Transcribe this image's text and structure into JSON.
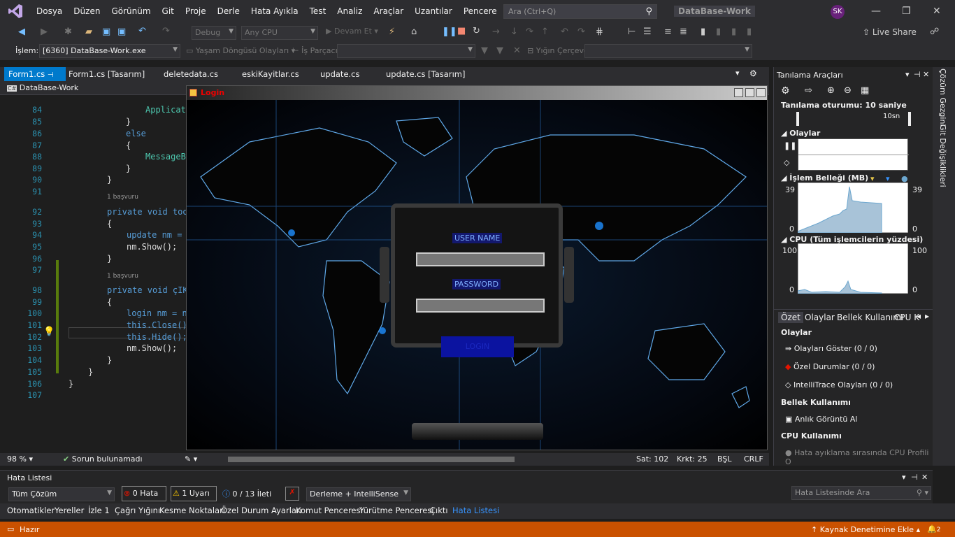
{
  "menu": {
    "items": [
      "Dosya",
      "Düzen",
      "Görünüm",
      "Git",
      "Proje",
      "Derle",
      "Hata Ayıkla",
      "Test",
      "Analiz",
      "Araçlar",
      "Uzantılar",
      "Pencere",
      "Yardım"
    ]
  },
  "search": {
    "placeholder": "Ara (Ctrl+Q)"
  },
  "solution_name": "DataBase-Work",
  "user_initials": "SK",
  "toolbar": {
    "config": "Debug",
    "platform": "Any CPU",
    "continue_label": "Devam Et",
    "live_share": "Live Share"
  },
  "debugbar": {
    "process_label": "İşlem:",
    "process_value": "[6360] DataBase-Work.exe",
    "lifecycle_label": "Yaşam Döngüsü Olayları",
    "thread_label": "İş Parçacığı:",
    "stackframe_label": "Yığın Çerçevesi:"
  },
  "tabs": [
    "Form1.cs",
    "Form1.cs [Tasarım]",
    "deletedata.cs",
    "eskiKayitlar.cs",
    "update.cs",
    "update.cs [Tasarım]"
  ],
  "navbar": {
    "project": "DataBase-Work"
  },
  "code": {
    "lines": [
      {
        "n": "84",
        "t": "Applicat"
      },
      {
        "n": "85",
        "t": "}"
      },
      {
        "n": "86",
        "t": "else"
      },
      {
        "n": "87",
        "t": "{"
      },
      {
        "n": "88",
        "t": "MessageB"
      },
      {
        "n": "89",
        "t": "}"
      },
      {
        "n": "90",
        "t": "}"
      },
      {
        "n": "91",
        "t": ""
      },
      {
        "n": "92",
        "t": "private void too"
      },
      {
        "n": "93",
        "t": "{"
      },
      {
        "n": "94",
        "t": "update nm = "
      },
      {
        "n": "95",
        "t": "nm.Show();"
      },
      {
        "n": "96",
        "t": "}"
      },
      {
        "n": "97",
        "t": ""
      },
      {
        "n": "98",
        "t": "private void çIK"
      },
      {
        "n": "99",
        "t": "{"
      },
      {
        "n": "100",
        "t": "login nm = n"
      },
      {
        "n": "101",
        "t": "this.Close()"
      },
      {
        "n": "102",
        "t": "this.Hide();"
      },
      {
        "n": "103",
        "t": "nm.Show();"
      },
      {
        "n": "104",
        "t": "}"
      },
      {
        "n": "105",
        "t": "}"
      },
      {
        "n": "106",
        "t": "}"
      },
      {
        "n": "107",
        "t": ""
      }
    ],
    "ref_hint": "1 başvuru"
  },
  "editor_status": {
    "zoom": "98 %",
    "issues": "Sorun bulunamadı",
    "line": "Sat: 102",
    "col": "Krkt: 25",
    "mode": "BŞL",
    "eol": "CRLF"
  },
  "login_form": {
    "title": "Login",
    "username_label": "USER NAME",
    "password_label": "PASSWORD",
    "login_button": "LOGIN"
  },
  "diagnostics": {
    "title": "Tanılama Araçları",
    "session": "Tanılama oturumu: 10 saniye",
    "tick": "10sn",
    "events_header": "Olaylar",
    "memory_header": "İşlem Belleği (MB)",
    "memory_max": "39",
    "memory_min": "0",
    "cpu_header": "CPU (Tüm işlemcilerin yüzdesi)",
    "cpu_max": "100",
    "cpu_min": "0",
    "tabs": [
      "Özet",
      "Olaylar",
      "Bellek Kullanımı",
      "CPU K"
    ],
    "section_events": "Olaylar",
    "show_events": "Olayları Göster (0 / 0)",
    "exceptions": "Özel Durumlar (0 / 0)",
    "intellitrace": "IntelliTrace Olayları (0 / 0)",
    "section_memory": "Bellek Kullanımı",
    "snapshot": "Anlık Görüntü Al",
    "section_cpu": "CPU Kullanımı",
    "cpu_profile": "Hata ayıklama sırasında CPU Profili O"
  },
  "sidebar": {
    "solution_explorer": "Çözüm Gezgini",
    "git_changes": "Git Değişiklikleri"
  },
  "error_list": {
    "title": "Hata Listesi",
    "scope": "Tüm Çözüm",
    "errors": "0 Hata",
    "warnings": "1 Uyarı",
    "messages": "0 / 13 İleti",
    "build": "Derleme + IntelliSense",
    "search": "Hata Listesinde Ara"
  },
  "bottom_tabs": [
    "Otomatikler",
    "Yereller",
    "İzle 1",
    "Çağrı Yığını",
    "Kesme Noktaları",
    "Özel Durum Ayarları",
    "Komut Penceresi",
    "Yürütme Penceresi",
    "Çıktı",
    "Hata Listesi"
  ],
  "status": {
    "ready": "Hazır",
    "source_control": "Kaynak Denetimine Ekle",
    "notifications": "2"
  },
  "colors": {
    "accent": "#007acc",
    "status_bar": "#ca5100",
    "login_button": "#0b13a0"
  }
}
